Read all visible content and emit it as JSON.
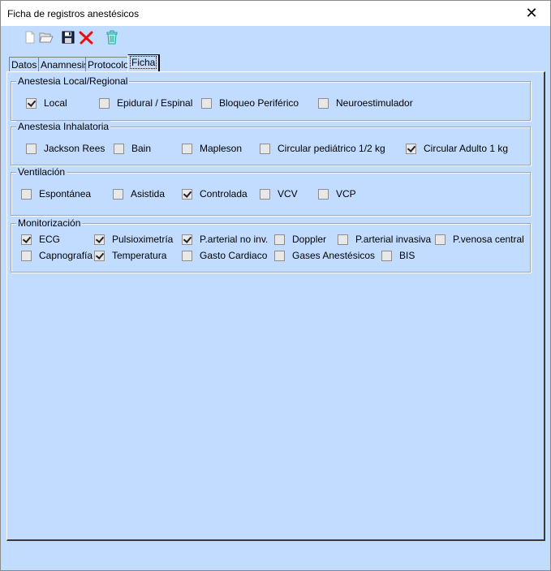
{
  "window": {
    "title": "Ficha de registros anestésicos",
    "close_glyph": "✕"
  },
  "toolbar": {
    "icons": [
      "new-document-icon",
      "open-folder-icon",
      "save-disk-icon",
      "delete-x-icon",
      "trash-can-icon"
    ],
    "colors": {
      "delete": "#e81010",
      "trash": "#12a89a"
    }
  },
  "tabs": [
    {
      "label": "Datos",
      "active": false
    },
    {
      "label": "Anamnesis",
      "active": false
    },
    {
      "label": "Protocolo",
      "active": false
    },
    {
      "label": "Ficha",
      "active": true
    }
  ],
  "groups": {
    "local": {
      "title": "Anestesia Local/Regional",
      "items": [
        {
          "label": "Local",
          "checked": true
        },
        {
          "label": "Epidural / Espinal",
          "checked": false
        },
        {
          "label": "Bloqueo Periférico",
          "checked": false
        },
        {
          "label": "Neuroestimulador",
          "checked": false
        }
      ]
    },
    "inhalatoria": {
      "title": "Anestesia Inhalatoria",
      "items": [
        {
          "label": "Jackson Rees",
          "checked": false
        },
        {
          "label": "Bain",
          "checked": false
        },
        {
          "label": "Mapleson",
          "checked": false
        },
        {
          "label": "Circular pediátrico 1/2 kg",
          "checked": false
        },
        {
          "label": "Circular Adulto 1 kg",
          "checked": true
        }
      ]
    },
    "ventilacion": {
      "title": "Ventilación",
      "items": [
        {
          "label": "Espontánea",
          "checked": false
        },
        {
          "label": "Asistida",
          "checked": false
        },
        {
          "label": "Controlada",
          "checked": true
        },
        {
          "label": "VCV",
          "checked": false
        },
        {
          "label": "VCP",
          "checked": false
        }
      ]
    },
    "monitorizacion": {
      "title": "Monitorización",
      "items": [
        {
          "label": "ECG",
          "checked": true
        },
        {
          "label": "Pulsioximetría",
          "checked": true
        },
        {
          "label": "P.arterial no inv.",
          "checked": true
        },
        {
          "label": "Doppler",
          "checked": false
        },
        {
          "label": "P.arterial invasiva",
          "checked": false
        },
        {
          "label": "P.venosa central",
          "checked": false
        },
        {
          "label": "Capnografía",
          "checked": false
        },
        {
          "label": "Temperatura",
          "checked": true
        },
        {
          "label": "Gasto Cardiaco",
          "checked": false
        },
        {
          "label": "Gases Anestésicos",
          "checked": false
        },
        {
          "label": "BIS",
          "checked": false
        }
      ]
    }
  }
}
